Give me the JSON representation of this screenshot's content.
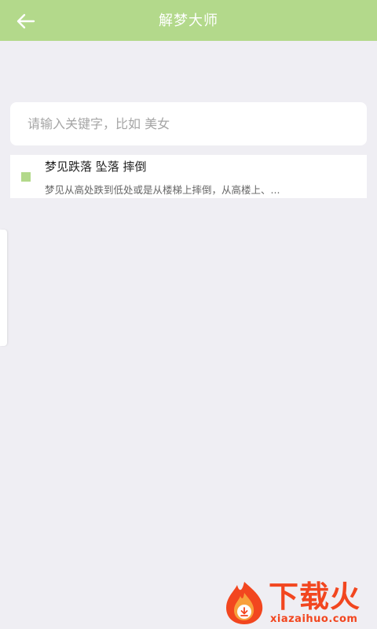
{
  "header": {
    "title": "解梦大师",
    "back_icon": "arrow-left-icon",
    "background": "#b3d98b"
  },
  "search": {
    "placeholder": "请输入关键字，比如 美女",
    "value": ""
  },
  "results": [
    {
      "title": "梦见跌落 坠落 摔倒",
      "description": "梦见从高处跌到低处或是从楼梯上摔倒，从高楼上、...",
      "marker_color": "#b3d98b"
    }
  ],
  "watermark": {
    "name": "下载火",
    "url": "xiazaihuo.com",
    "color": "#f2461f"
  }
}
